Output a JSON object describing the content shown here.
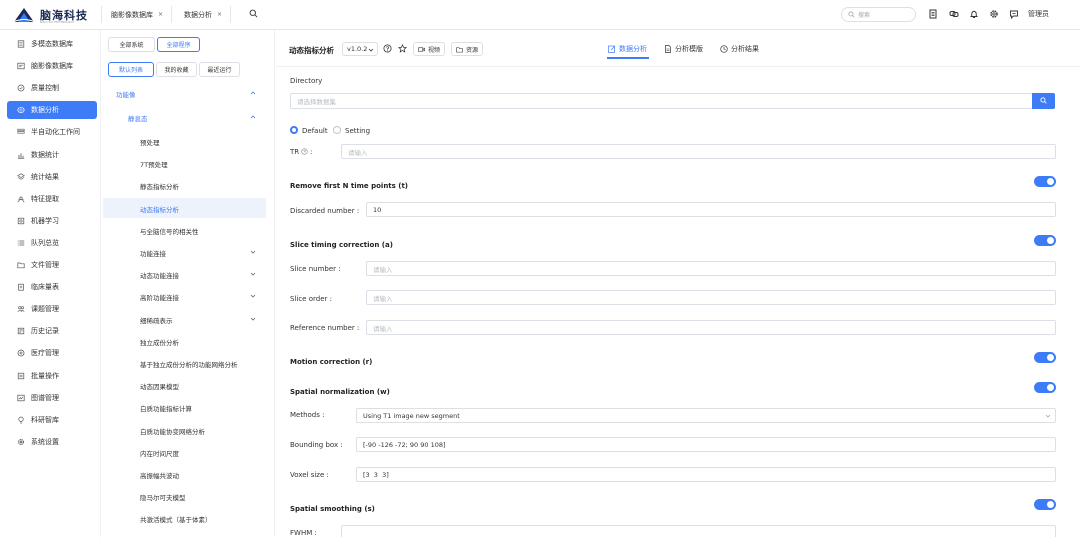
{
  "brand": {
    "name": "脑海科技",
    "sub": "NAO HAI TECHNOLOGY"
  },
  "tabs": [
    {
      "label": "脑影像数据库",
      "close": "×"
    },
    {
      "label": "数据分析",
      "close": "×"
    }
  ],
  "header": {
    "search_placeholder": "搜索",
    "user": "管理员"
  },
  "sidebar": {
    "items": [
      {
        "label": "多模态数据库",
        "icon": "database-icon"
      },
      {
        "label": "脑影像数据库",
        "icon": "brain-image-icon"
      },
      {
        "label": "质量控制",
        "icon": "quality-icon"
      },
      {
        "label": "数据分析",
        "icon": "analysis-icon",
        "active": true
      },
      {
        "label": "半自动化工作间",
        "icon": "workshop-icon"
      },
      {
        "label": "数据统计",
        "icon": "stats-icon"
      },
      {
        "label": "统计结果",
        "icon": "layers-icon"
      },
      {
        "label": "特征提取",
        "icon": "feature-icon"
      },
      {
        "label": "机器学习",
        "icon": "ml-icon"
      },
      {
        "label": "队列总览",
        "icon": "list-icon"
      },
      {
        "label": "文件管理",
        "icon": "folder-icon"
      },
      {
        "label": "临床量表",
        "icon": "clinical-icon"
      },
      {
        "label": "课题管理",
        "icon": "users-icon"
      },
      {
        "label": "历史记录",
        "icon": "history-icon"
      },
      {
        "label": "医疗管理",
        "icon": "medical-icon"
      },
      {
        "label": "批量操作",
        "icon": "batch-icon"
      },
      {
        "label": "图谱管理",
        "icon": "atlas-icon"
      },
      {
        "label": "科研智库",
        "icon": "bulb-icon"
      },
      {
        "label": "系统设置",
        "icon": "settings-icon"
      }
    ]
  },
  "panel": {
    "filter1": [
      "全部系统",
      "全部程序"
    ],
    "filter2": [
      "默认列表",
      "我的收藏",
      "最近运行"
    ],
    "group": "功能像",
    "subgroup": "静息态",
    "items": [
      "预处理",
      "7T预处理",
      "静态指标分析",
      "动态指标分析",
      "与全脑信号的相关性",
      "功能连接",
      "动态功能连接",
      "高阶功能连接",
      "细稀疏表示",
      "独立成份分析",
      "基于独立成份分析的功能网络分析",
      "动态因果模型",
      "白质功能指标计算",
      "白质功能协变网络分析",
      "内在时间尺度",
      "高振幅共波动",
      "隐马尔可夫模型",
      "共激活模式（基于体素）"
    ]
  },
  "toolbar": {
    "title": "动态指标分析",
    "version": "v1.0.2",
    "video": "视频",
    "resource": "资源",
    "tabs": [
      "数据分析",
      "分析模版",
      "分析结果"
    ]
  },
  "form": {
    "directory_label": "Directory",
    "directory_placeholder": "请选择数据集",
    "radio_default": "Default",
    "radio_setting": "Setting",
    "tr_label": "TR",
    "tr_suffix": ":",
    "tr_placeholder": "请输入",
    "sec_remove": "Remove first N time points (t)",
    "discarded_label": "Discarded number :",
    "discarded_value": "10",
    "sec_slice": "Slice timing correction (a)",
    "slice_number_label": "Slice number :",
    "slice_order_label": "Slice order :",
    "reference_label": "Reference number :",
    "placeholder": "请输入",
    "sec_motion": "Motion correction (r)",
    "sec_spatial": "Spatial normalization (w)",
    "methods_label": "Methods :",
    "methods_value": "Using T1 image new segment",
    "bbox_label": "Bounding box :",
    "bbox_value": "[-90 -126 -72; 90 90 108]",
    "voxel_label": "Voxel size :",
    "voxel_value": "[3  3  3]",
    "sec_smooth": "Spatial smoothing (s)",
    "fwhm_label": "FWHM :"
  },
  "colors": {
    "accent": "#3d7bf7"
  }
}
